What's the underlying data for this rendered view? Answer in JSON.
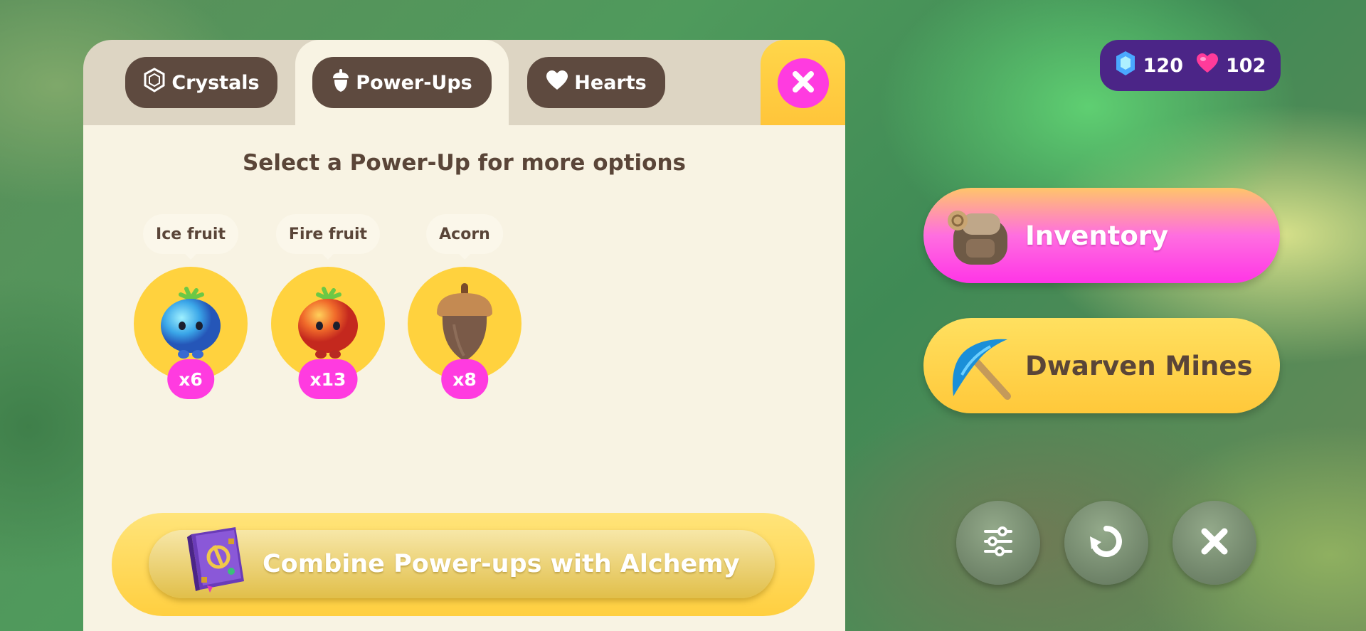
{
  "tabs": [
    {
      "label": "Crystals",
      "icon": "crystal-icon"
    },
    {
      "label": "Power-Ups",
      "icon": "acorn-icon",
      "active": true
    },
    {
      "label": "Hearts",
      "icon": "heart-icon"
    }
  ],
  "close_icon": "close-icon",
  "heading": "Select a Power-Up for more options",
  "powerups": [
    {
      "name": "Ice fruit",
      "count": "x6",
      "icon": "ice-fruit-icon"
    },
    {
      "name": "Fire fruit",
      "count": "x13",
      "icon": "fire-fruit-icon"
    },
    {
      "name": "Acorn",
      "count": "x8",
      "icon": "acorn-item-icon"
    }
  ],
  "alchemy_button": {
    "label": "Combine Power-ups with Alchemy",
    "icon": "spellbook-icon"
  },
  "currency": {
    "crystals": "120",
    "hearts": "102"
  },
  "side_buttons": {
    "inventory": {
      "label": "Inventory",
      "icon": "backpack-icon"
    },
    "mines": {
      "label": "Dwarven Mines",
      "icon": "pickaxe-icon"
    }
  },
  "bottom_buttons": [
    "settings-sliders-icon",
    "refresh-icon",
    "close-icon"
  ],
  "colors": {
    "accent_pink": "#ff3be0",
    "accent_yellow": "#ffd23e",
    "tab_brown": "#5e4a3f",
    "currency_purple": "#4b2587"
  }
}
